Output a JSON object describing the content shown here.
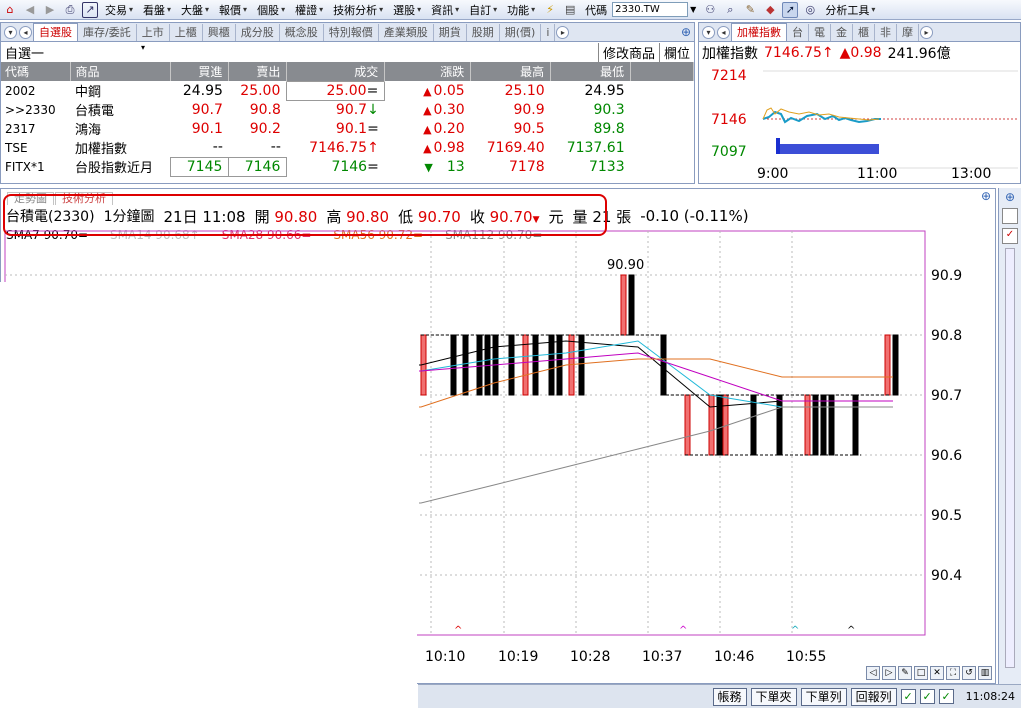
{
  "toolbar": {
    "menus": [
      "交易",
      "看盤",
      "大盤",
      "報價",
      "個股",
      "權證",
      "技術分析",
      "選股",
      "資訊",
      "自訂",
      "功能"
    ],
    "code_label": "代碼",
    "code_value": "2330.TW",
    "analysis_tools": "分析工具"
  },
  "watchlist": {
    "tabs": [
      "自選股",
      "庫存/委託",
      "上市",
      "上櫃",
      "興櫃",
      "成分股",
      "概念股",
      "特別報價",
      "產業類股",
      "期貨",
      "股期",
      "期(價)",
      "i"
    ],
    "group": "自選一",
    "modify_label": "修改商品",
    "fields_label": "欄位",
    "columns": [
      "代碼",
      "商品",
      "買進",
      "賣出",
      "成交",
      "漲跌",
      "最高",
      "最低"
    ],
    "rows": [
      {
        "code": "2002",
        "name": "中鋼",
        "bid": "24.95",
        "ask": "25.00",
        "last": "25.00",
        "last_mark": "=",
        "chg": "0.05",
        "chg_dir": "up",
        "high": "25.10",
        "low": "24.95",
        "bid_c": "fl",
        "ask_c": "up",
        "last_c": "up",
        "high_c": "up",
        "low_c": "fl"
      },
      {
        "code": ">>2330",
        "name": "台積電",
        "bid": "90.7",
        "ask": "90.8",
        "last": "90.7",
        "last_mark": "↓",
        "chg": "0.30",
        "chg_dir": "up",
        "high": "90.9",
        "low": "90.3",
        "bid_c": "up",
        "ask_c": "up",
        "last_c": "up",
        "high_c": "up",
        "low_c": "dn"
      },
      {
        "code": "2317",
        "name": "鴻海",
        "bid": "90.1",
        "ask": "90.2",
        "last": "90.1",
        "last_mark": "=",
        "chg": "0.20",
        "chg_dir": "up",
        "high": "90.5",
        "low": "89.8",
        "bid_c": "up",
        "ask_c": "up",
        "last_c": "up",
        "high_c": "up",
        "low_c": "dn"
      },
      {
        "code": "TSE",
        "name": "加權指數",
        "bid": "--",
        "ask": "--",
        "last": "7146.75",
        "last_mark": "↑",
        "chg": "0.98",
        "chg_dir": "up",
        "high": "7169.40",
        "low": "7137.61",
        "bid_c": "fl",
        "ask_c": "fl",
        "last_c": "up",
        "high_c": "up",
        "low_c": "dn"
      },
      {
        "code": "FITX*1",
        "name": "台股指數近月",
        "bid": "7145",
        "ask": "7146",
        "last": "7146",
        "last_mark": "=",
        "chg": "13",
        "chg_dir": "dn",
        "high": "7178",
        "low": "7133",
        "bid_c": "dn",
        "ask_c": "dn",
        "last_c": "dn",
        "high_c": "up",
        "low_c": "dn"
      }
    ]
  },
  "index_panel": {
    "tabs": [
      "加權指數",
      "台",
      "電",
      "金",
      "櫃",
      "非",
      "摩"
    ],
    "name": "加權指數",
    "value": "7146.75",
    "change": "0.98",
    "volume": "241.96億",
    "y_ticks": [
      "7214",
      "7146",
      "7097"
    ],
    "x_ticks": [
      "9:00",
      "11:00",
      "13:00"
    ],
    "line_color": "#1a9cc8",
    "ref_color": "#d04040"
  },
  "chart": {
    "tabs": [
      "走勢圖",
      "技術分析"
    ],
    "stock": "台積電(2330)",
    "period": "1分鐘圖",
    "datetime": "21日 11:08",
    "open_label": "開",
    "open": "90.80",
    "high_label": "高",
    "high": "90.80",
    "low_label": "低",
    "low": "90.70",
    "close_label": "收",
    "close": "90.70",
    "unit": "元",
    "vol_label": "量",
    "volume": "21",
    "vol_unit": "張",
    "change": "-0.10 (-0.11%)",
    "ma": [
      {
        "label": "SMA7",
        "value": "90.70",
        "mark": "=",
        "color": "#000000"
      },
      {
        "label": "SMA14",
        "value": "90.68",
        "mark": "↑",
        "color": "#bbbbbb"
      },
      {
        "label": "SMA28",
        "value": "90.66",
        "mark": "=",
        "color": "#e0306a"
      },
      {
        "label": "SMA56",
        "value": "90.72",
        "mark": "=",
        "color": "#e07020"
      },
      {
        "label": "SMA112",
        "value": "90.70",
        "mark": "=",
        "color": "#888888"
      }
    ],
    "peak_label": "90.90",
    "y_ticks": [
      "90.9",
      "90.8",
      "90.7",
      "90.6",
      "90.5",
      "90.4"
    ],
    "x_ticks": [
      "10:10",
      "10:19",
      "10:28",
      "10:37",
      "10:46",
      "10:55"
    ]
  },
  "chart_data": {
    "type": "bar",
    "title": "台積電(2330) 1分鐘圖",
    "xlabel": "",
    "ylabel": "",
    "ylim": [
      90.35,
      90.95
    ],
    "categories": [
      "10:10",
      "10:19",
      "10:28",
      "10:37",
      "10:46",
      "10:55"
    ],
    "series": [
      {
        "name": "SMA7",
        "values": [
          90.75,
          90.78,
          90.79,
          90.78,
          90.68,
          90.69
        ]
      },
      {
        "name": "SMA14",
        "values": [
          90.74,
          90.76,
          90.77,
          90.79,
          90.7,
          90.68
        ]
      },
      {
        "name": "SMA28",
        "values": [
          90.74,
          90.75,
          90.76,
          90.77,
          90.73,
          90.69
        ]
      },
      {
        "name": "SMA56",
        "values": [
          90.68,
          90.72,
          90.75,
          90.76,
          90.76,
          90.73
        ]
      },
      {
        "name": "SMA112",
        "values": [
          90.52,
          90.55,
          90.58,
          90.61,
          90.64,
          90.68
        ]
      }
    ]
  },
  "status": {
    "buttons": [
      "帳務",
      "下單夾",
      "下單列",
      "回報列"
    ],
    "time": "11:08:24"
  }
}
